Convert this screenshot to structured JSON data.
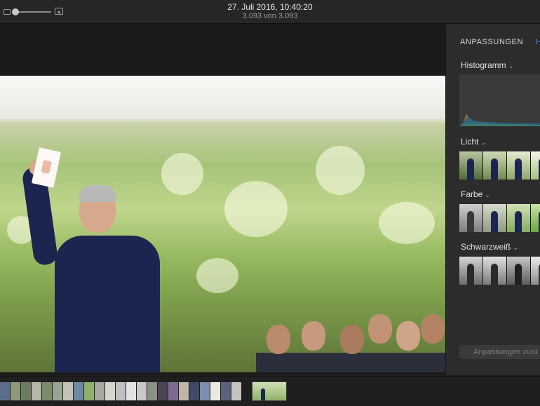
{
  "toolbar": {
    "title": "27. Juli 2016, 10:40:20",
    "subtitle": "3.093 von 3.093",
    "zoom_small_icon": "zoom-out-icon",
    "zoom_large_icon": "zoom-in-icon",
    "zoom_level": 0.05
  },
  "panel": {
    "tab_adjust": "ANPASSUNGEN",
    "tab_second": "H",
    "sections": [
      {
        "label": "Histogramm"
      },
      {
        "label": "Licht"
      },
      {
        "label": "Farbe"
      },
      {
        "label": "Schwarzweiß"
      }
    ],
    "reset_label": "Anpassungen zurü",
    "accent_color": "#2f8cf0"
  },
  "filmstrip": {
    "thumb_colors": [
      "#5b6f8a",
      "#8d9a7a",
      "#6b7c63",
      "#b5b8a8",
      "#7a8c6a",
      "#9aa590",
      "#c4c2b8",
      "#6d8aa3",
      "#8fb06a",
      "#a7a9a0",
      "#d9d4cb",
      "#bfbfbf",
      "#e1e1df",
      "#c8c8c6",
      "#8a8f87",
      "#4b4456",
      "#7e6a93",
      "#c0b6a9",
      "#3e4b63",
      "#7d8db0",
      "#ece9e3",
      "#5a6378",
      "#c5c3bf"
    ],
    "selected_index": 23
  }
}
